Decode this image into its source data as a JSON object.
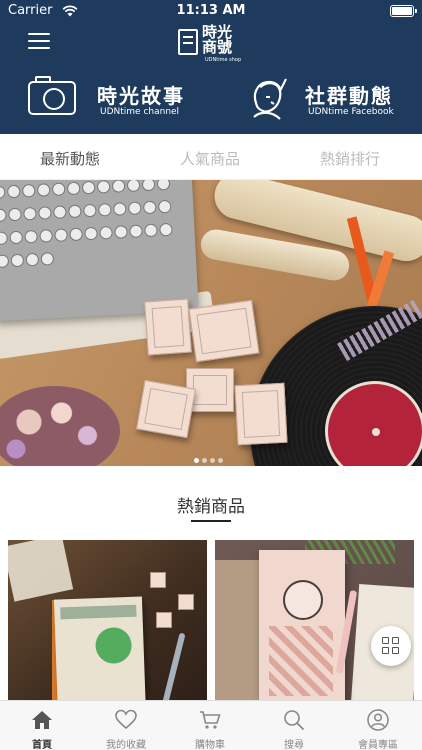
{
  "status_bar": {
    "carrier": "Carrier",
    "time": "11:13 AM"
  },
  "header": {
    "logo_title": "時光商號",
    "logo_subtitle": "UDNtime shop",
    "channels": [
      {
        "title": "時光故事",
        "subtitle": "UDNtime channel",
        "icon": "camera-icon"
      },
      {
        "title": "社群動態",
        "subtitle": "UDNtime Facebook",
        "icon": "portrait-icon"
      }
    ]
  },
  "tabs": [
    {
      "label": "最新動態",
      "active": true
    },
    {
      "label": "人氣商品",
      "active": false
    },
    {
      "label": "熱銷排行",
      "active": false
    }
  ],
  "banner": {
    "page_count": 4,
    "active_index": 0
  },
  "section": {
    "title": "熱銷商品"
  },
  "bottom_nav": [
    {
      "label": "首頁",
      "icon": "home-icon",
      "active": true
    },
    {
      "label": "我的收藏",
      "icon": "heart-icon",
      "active": false
    },
    {
      "label": "購物車",
      "icon": "cart-icon",
      "active": false
    },
    {
      "label": "搜尋",
      "icon": "search-icon",
      "active": false
    },
    {
      "label": "會員專區",
      "icon": "user-icon",
      "active": false
    }
  ],
  "colors": {
    "header_bg": "#1e3a5c",
    "nav_bg": "#f7f7f7",
    "active_tab_text": "#555555",
    "inactive_tab_text": "#bbbbbb"
  }
}
